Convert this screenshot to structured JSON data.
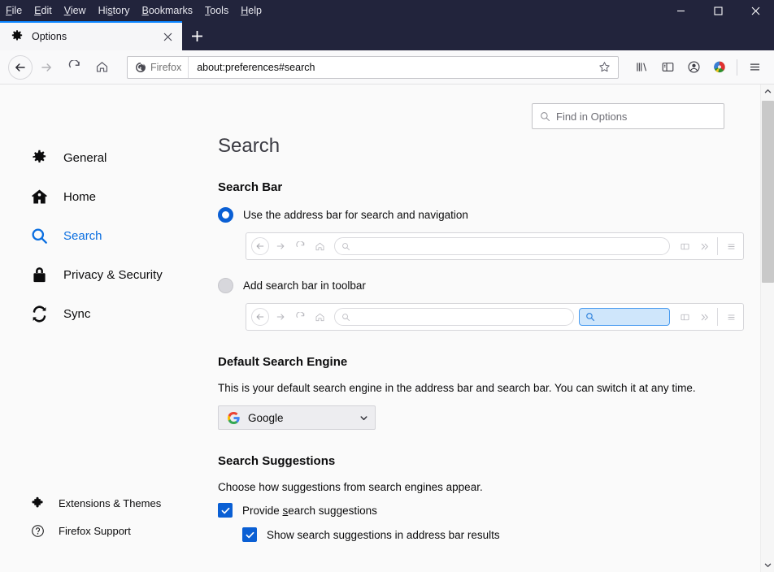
{
  "window": {
    "menus": [
      {
        "pre": "",
        "key": "F",
        "post": "ile"
      },
      {
        "pre": "",
        "key": "E",
        "post": "dit"
      },
      {
        "pre": "",
        "key": "V",
        "post": "iew"
      },
      {
        "pre": "Hi",
        "key": "s",
        "post": "tory"
      },
      {
        "pre": "",
        "key": "B",
        "post": "ookmarks"
      },
      {
        "pre": "",
        "key": "T",
        "post": "ools"
      },
      {
        "pre": "",
        "key": "H",
        "post": "elp"
      }
    ],
    "controls": {
      "minimize": "minimize-button",
      "maximize": "maximize-button",
      "close": "close-button"
    },
    "titlebar_color": "#22243c"
  },
  "tabs": {
    "active_tab_title": "Options",
    "active_tab_accent": "#0a84ff",
    "close_label": "Close tab",
    "new_tab_label": "New tab"
  },
  "navbar": {
    "back_label": "Back",
    "forward_label": "Forward",
    "reload_label": "Reload",
    "home_label": "Home",
    "identity_label": "Firefox",
    "url": "about:preferences#search",
    "bookmark_label": "Bookmark this page",
    "icons": {
      "library": "library-icon",
      "sidebar": "sidebar-icon",
      "account": "account-icon",
      "extension": "extension-globe-icon",
      "menu": "app-menu-icon"
    }
  },
  "search": {
    "placeholder": "Find in Options"
  },
  "sidebar": {
    "items": [
      {
        "label": "General",
        "icon": "gear-icon",
        "active": false
      },
      {
        "label": "Home",
        "icon": "home-icon",
        "active": false
      },
      {
        "label": "Search",
        "icon": "search-icon",
        "active": true
      },
      {
        "label": "Privacy & Security",
        "icon": "lock-icon",
        "active": false
      },
      {
        "label": "Sync",
        "icon": "sync-icon",
        "active": false
      }
    ],
    "footer": [
      {
        "label": "Extensions & Themes",
        "icon": "puzzle-icon"
      },
      {
        "label": "Firefox Support",
        "icon": "question-circle-icon"
      }
    ],
    "active_color": "#0a6ee0"
  },
  "main": {
    "page_title": "Search",
    "search_bar": {
      "heading": "Search Bar",
      "option_address_bar": "Use the address bar for search and navigation",
      "option_search_bar": "Add search bar in toolbar",
      "selected": "address_bar",
      "highlight_color": "#cfe6fb"
    },
    "default_engine": {
      "heading": "Default Search Engine",
      "description": "This is your default search engine in the address bar and search bar. You can switch it at any time.",
      "selected": "Google",
      "icon": "google-g-icon"
    },
    "suggestions": {
      "heading": "Search Suggestions",
      "description": "Choose how suggestions from search engines appear.",
      "items": [
        {
          "pre": "Provide ",
          "key": "s",
          "post": "earch suggestions",
          "checked": true,
          "indent": false
        },
        {
          "pre": "Show search suggestions in address bar results",
          "key": "",
          "post": "",
          "checked": true,
          "indent": true
        }
      ]
    }
  },
  "scrollbar": {
    "up_label": "Scroll up",
    "down_label": "Scroll down",
    "thumb_label": "Scroll thumb"
  }
}
